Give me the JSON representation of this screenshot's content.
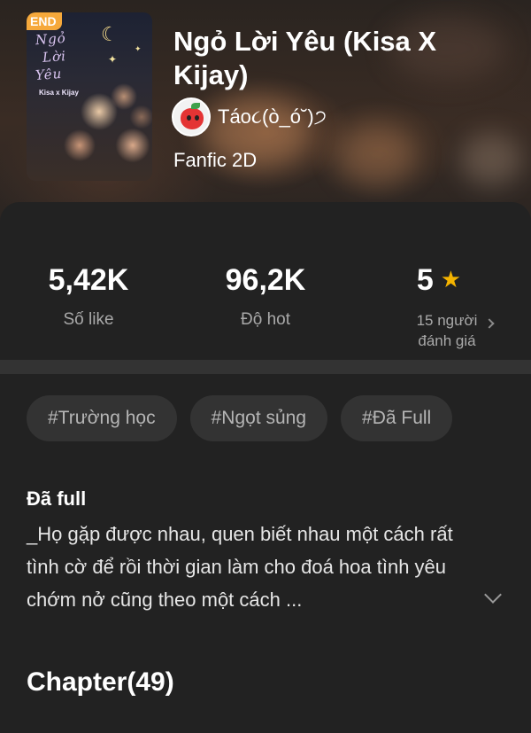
{
  "book": {
    "cover_badge": "END",
    "cover_script": [
      "Ngỏ",
      "Lời",
      "Yêu"
    ],
    "cover_subtitle": "Kisa x Kijay",
    "title": "Ngỏ Lời Yêu (Kisa X Kijay)",
    "author": "Táo૮(ò_ó˘)੭",
    "genre": "Fanfic 2D"
  },
  "stats": {
    "likes": {
      "value": "5,42K",
      "label": "Số like"
    },
    "hot": {
      "value": "96,2K",
      "label": "Độ hot"
    },
    "rating": {
      "value": "5",
      "label": "15 người đánh giá"
    }
  },
  "tags": [
    "#Trường học",
    "#Ngọt sủng",
    "#Đã Full"
  ],
  "description": {
    "heading": "Đã full",
    "text": "_Họ gặp được nhau, quen biết nhau một cách rất tình cờ để rồi thời gian làm cho đoá hoa tình yêu chớm nở cũng theo một cách ..."
  },
  "chapters_label": "Chapter(49)",
  "colors": {
    "accent_star": "#f5b400",
    "badge": "#f6a93b",
    "panel": "#222222"
  },
  "icons": [
    "moon-icon",
    "star-icon",
    "chevron-right-icon",
    "chevron-down-icon",
    "apple-avatar-icon"
  ]
}
